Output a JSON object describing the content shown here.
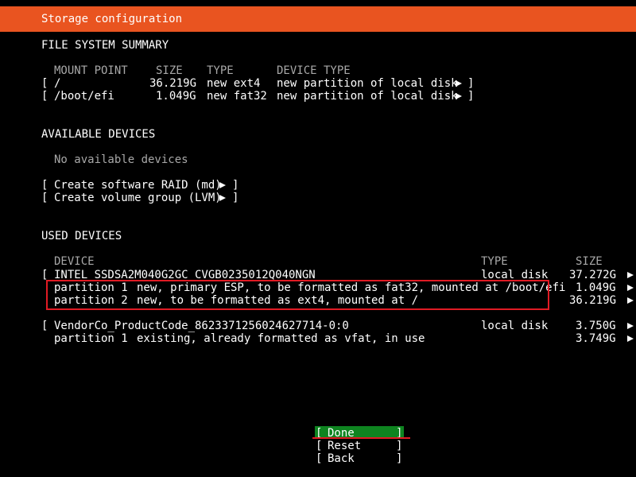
{
  "colors": {
    "accent": "#e95420",
    "focus": "#0e8420",
    "highlight": "#e01b24"
  },
  "header": {
    "title": "Storage configuration"
  },
  "fs_summary": {
    "heading": "FILE SYSTEM SUMMARY",
    "columns": {
      "mount": "MOUNT POINT",
      "size": "SIZE",
      "type": "TYPE",
      "device_type": "DEVICE TYPE"
    },
    "rows": [
      {
        "open": "[",
        "mount": "/",
        "size": "36.219G",
        "type": "new ext4",
        "device_type": "new partition of local disk",
        "close": "]"
      },
      {
        "open": "[",
        "mount": "/boot/efi",
        "size": "1.049G",
        "type": "new fat32",
        "device_type": "new partition of local disk",
        "close": "]"
      }
    ]
  },
  "available": {
    "heading": "AVAILABLE DEVICES",
    "empty": "No available devices",
    "actions": [
      {
        "open": "[",
        "label": "Create software RAID (md)",
        "close": "]"
      },
      {
        "open": "[",
        "label": "Create volume group (LVM)",
        "close": "]"
      }
    ]
  },
  "used": {
    "heading": "USED DEVICES",
    "columns": {
      "device": "DEVICE",
      "type": "TYPE",
      "size": "SIZE"
    },
    "disk1": {
      "open": "[",
      "name": "INTEL_SSDSA2M040G2GC_CVGB0235012Q040NGN",
      "type": "local disk",
      "size": "37.272G",
      "partitions": [
        {
          "name": "partition 1",
          "desc": "new, primary ESP, to be formatted as fat32, mounted at /boot/efi",
          "size": "1.049G"
        },
        {
          "name": "partition 2",
          "desc": "new, to be formatted as ext4, mounted at /",
          "size": "36.219G"
        }
      ]
    },
    "disk2": {
      "open": "[",
      "name": "VendorCo_ProductCode_8623371256024627714-0:0",
      "type": "local disk",
      "size": "3.750G",
      "partitions": [
        {
          "name": "partition 1",
          "desc": "existing, already formatted as vfat, in use",
          "size": "3.749G"
        }
      ]
    }
  },
  "buttons": {
    "done": {
      "open": "[",
      "label": "Done",
      "close": "]"
    },
    "reset": {
      "open": "[",
      "label": "Reset",
      "close": "]"
    },
    "back": {
      "open": "[",
      "label": "Back",
      "close": "]"
    }
  }
}
